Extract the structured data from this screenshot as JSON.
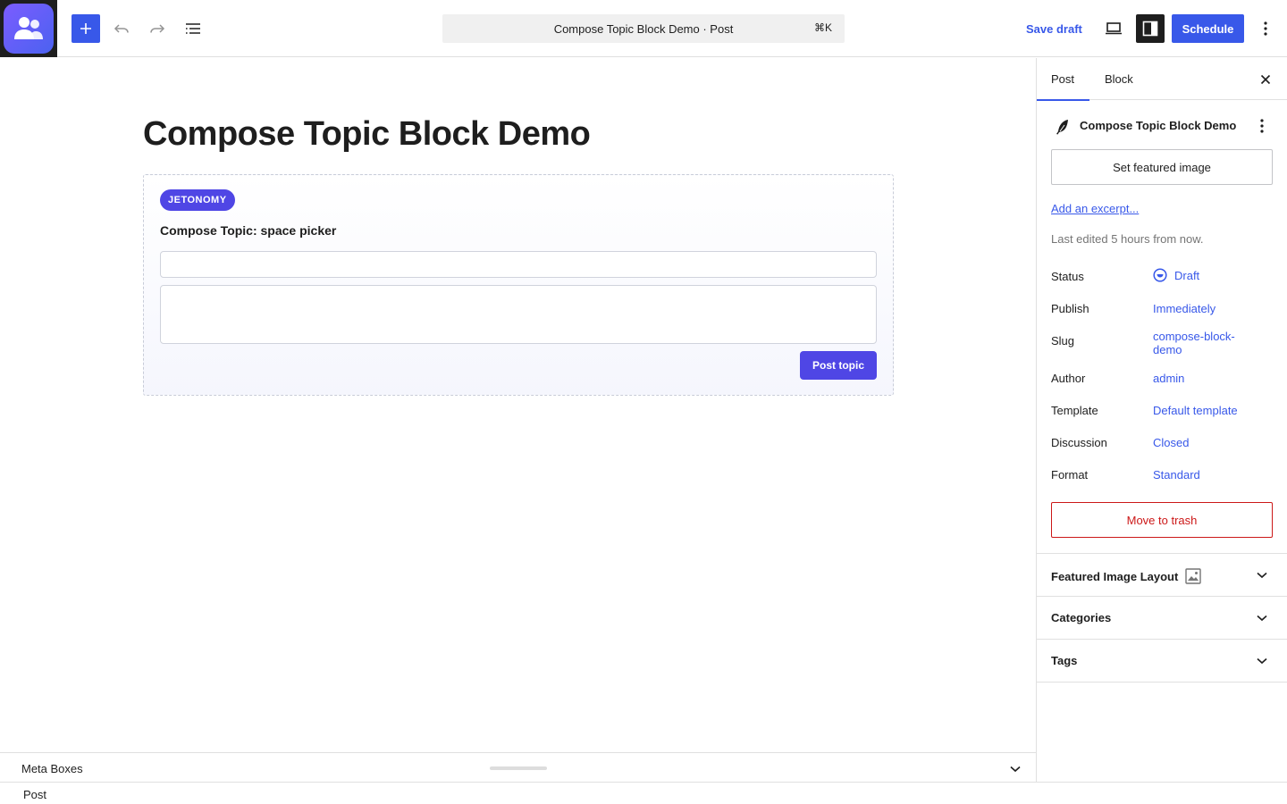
{
  "toolbar": {
    "document_title": "Compose Topic Block Demo · Post",
    "shortcut": "⌘K",
    "save_draft": "Save draft",
    "schedule": "Schedule"
  },
  "editor": {
    "post_title": "Compose Topic Block Demo",
    "block": {
      "badge": "JETONOMY",
      "heading": "Compose Topic: space picker",
      "title_value": "",
      "body_value": "",
      "submit_label": "Post topic"
    }
  },
  "meta_boxes": {
    "label": "Meta Boxes"
  },
  "footer": {
    "breadcrumb": "Post"
  },
  "sidebar": {
    "tabs": [
      {
        "label": "Post",
        "active": true
      },
      {
        "label": "Block",
        "active": false
      }
    ],
    "post_card_title": "Compose Topic Block Demo",
    "set_featured_image": "Set featured image",
    "add_excerpt": "Add an excerpt...",
    "last_edited": "Last edited 5 hours from now.",
    "rows": [
      {
        "label": "Status",
        "value": "Draft"
      },
      {
        "label": "Publish",
        "value": "Immediately"
      },
      {
        "label": "Slug",
        "value": "compose-block-demo"
      },
      {
        "label": "Author",
        "value": "admin"
      },
      {
        "label": "Template",
        "value": "Default template"
      },
      {
        "label": "Discussion",
        "value": "Closed"
      },
      {
        "label": "Format",
        "value": "Standard"
      }
    ],
    "move_to_trash": "Move to trash",
    "panels": [
      {
        "label": "Featured Image Layout"
      },
      {
        "label": "Categories"
      },
      {
        "label": "Tags"
      }
    ]
  },
  "colors": {
    "accent": "#3858e9",
    "block_accent": "#4f46e5",
    "danger": "#cc1818"
  }
}
